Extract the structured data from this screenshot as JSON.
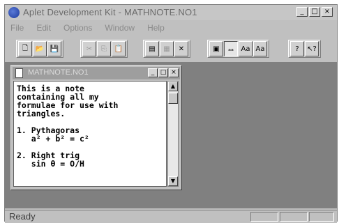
{
  "app": {
    "title": "Aplet Development Kit - MATHNOTE.NO1",
    "window_buttons": [
      "_",
      "□",
      "×"
    ]
  },
  "menu": [
    "File",
    "Edit",
    "Options",
    "Window",
    "Help"
  ],
  "toolbar": {
    "groups": [
      [
        {
          "name": "new-file-icon",
          "glyph": "🗋"
        },
        {
          "name": "open-folder-icon",
          "glyph": "📂"
        },
        {
          "name": "save-icon",
          "glyph": "💾"
        }
      ],
      [
        {
          "name": "cut-icon",
          "glyph": "✂"
        },
        {
          "name": "copy-icon",
          "glyph": "⎘"
        },
        {
          "name": "paste-icon",
          "glyph": "📋"
        }
      ],
      [
        {
          "name": "form-icon",
          "glyph": "▤"
        },
        {
          "name": "grid-icon",
          "glyph": "▦"
        },
        {
          "name": "delete-icon",
          "glyph": "✕"
        }
      ],
      [
        {
          "name": "calculator-icon",
          "glyph": "▣"
        },
        {
          "name": "font-small-icon",
          "glyph": "ₐₐ"
        },
        {
          "name": "font-medium-icon",
          "glyph": "Aa"
        },
        {
          "name": "font-large-icon",
          "glyph": "Aa"
        }
      ],
      [
        {
          "name": "info-icon",
          "glyph": "?"
        },
        {
          "name": "context-help-icon",
          "glyph": "↖?"
        }
      ]
    ]
  },
  "child_window": {
    "title": "MATHNOTE.NO1",
    "buttons": [
      "_",
      "□",
      "×"
    ],
    "note_text": "This is a note\ncontaining all my\nformulae for use with\ntriangles.\n\n1. Pythagoras\n   a² + b² = c²\n\n2. Right trig\n   sin θ = O/H"
  },
  "status": "Ready"
}
